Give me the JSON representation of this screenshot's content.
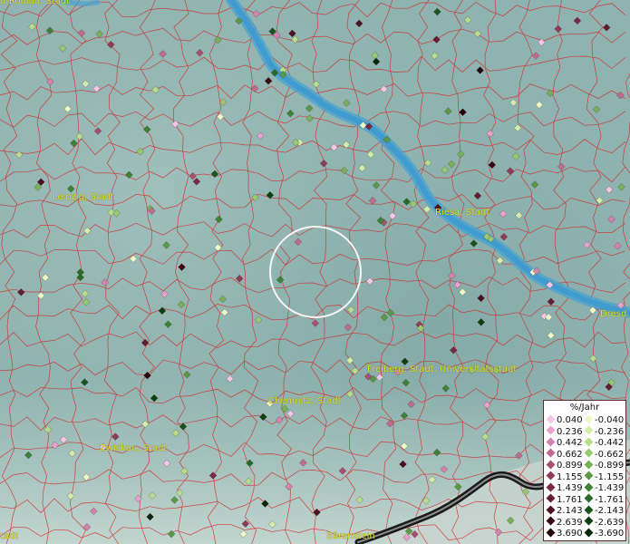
{
  "places": [
    {
      "name": "u-Roßlau, Stadt"
    },
    {
      "name": "Leipzig, Stadt"
    },
    {
      "name": "Riesa, Stadt"
    },
    {
      "name": "Dresd"
    },
    {
      "name": "Freiberg, Stadt, Universitätsstadt"
    },
    {
      "name": "Chemnitz, Stadt"
    },
    {
      "name": "Zwickau, Stadt"
    },
    {
      "name": "tadt"
    },
    {
      "name": "Bärenstein"
    }
  ],
  "legend": {
    "title": "%/Jahr",
    "positive": [
      {
        "label": "0.040",
        "color": "#f4c6e6"
      },
      {
        "label": "0.236",
        "color": "#e8a0cc"
      },
      {
        "label": "0.442",
        "color": "#d483ad"
      },
      {
        "label": "0.662",
        "color": "#c06a8e"
      },
      {
        "label": "0.899",
        "color": "#a8506f"
      },
      {
        "label": "1.155",
        "color": "#8f3a56"
      },
      {
        "label": "1.439",
        "color": "#7a2a42"
      },
      {
        "label": "1.761",
        "color": "#631c30"
      },
      {
        "label": "2.143",
        "color": "#4e1020"
      },
      {
        "label": "2.639",
        "color": "#390612"
      },
      {
        "label": "3.690",
        "color": "#220208"
      }
    ],
    "negative": [
      {
        "label": "-0.040",
        "color": "#eef7c8"
      },
      {
        "label": "-0.236",
        "color": "#d4ecaa"
      },
      {
        "label": "-0.442",
        "color": "#b8dc8c"
      },
      {
        "label": "-0.662",
        "color": "#98c870"
      },
      {
        "label": "-0.899",
        "color": "#78b05a"
      },
      {
        "label": "-1.155",
        "color": "#5a9a46"
      },
      {
        "label": "-1.439",
        "color": "#3e8236"
      },
      {
        "label": "-1.761",
        "color": "#2a6a28"
      },
      {
        "label": "-2.143",
        "color": "#1a541c"
      },
      {
        "label": "-2.639",
        "color": "#0e3e12"
      },
      {
        "label": "-3.690",
        "color": "#062808"
      }
    ]
  },
  "colors": {
    "background": "#8fb3b0",
    "borders": "#d42a2a",
    "river": "#4aa3d0",
    "place_label": "#e8e01a",
    "circle": "#ffffff"
  },
  "markers": [
    {
      "cls": 3,
      "sign": "p"
    },
    {
      "cls": 0,
      "sign": "n"
    },
    {
      "cls": 5,
      "sign": "n"
    },
    {
      "cls": 2,
      "sign": "n"
    },
    {
      "cls": 1,
      "sign": "p"
    },
    {
      "cls": 0,
      "sign": "n"
    },
    {
      "cls": 8,
      "sign": "p"
    },
    {
      "cls": 3,
      "sign": "n"
    },
    {
      "cls": 2,
      "sign": "p"
    },
    {
      "cls": 6,
      "sign": "n"
    },
    {
      "cls": 4,
      "sign": "n"
    },
    {
      "cls": 1,
      "sign": "n"
    },
    {
      "cls": 5,
      "sign": "p"
    },
    {
      "cls": 0,
      "sign": "p"
    },
    {
      "cls": 2,
      "sign": "n"
    },
    {
      "cls": 7,
      "sign": "p"
    },
    {
      "cls": 3,
      "sign": "p"
    },
    {
      "cls": 1,
      "sign": "n"
    },
    {
      "cls": 4,
      "sign": "p"
    },
    {
      "cls": 6,
      "sign": "n"
    },
    {
      "cls": 2,
      "sign": "p"
    },
    {
      "cls": 0,
      "sign": "n"
    },
    {
      "cls": 5,
      "sign": "n"
    },
    {
      "cls": 9,
      "sign": "n"
    },
    {
      "cls": 1,
      "sign": "p"
    },
    {
      "cls": 3,
      "sign": "n"
    },
    {
      "cls": 2,
      "sign": "n"
    },
    {
      "cls": 6,
      "sign": "p"
    },
    {
      "cls": 4,
      "sign": "n"
    },
    {
      "cls": 0,
      "sign": "p"
    },
    {
      "cls": 8,
      "sign": "n"
    },
    {
      "cls": 2,
      "sign": "p"
    },
    {
      "cls": 1,
      "sign": "n"
    },
    {
      "cls": 5,
      "sign": "p"
    },
    {
      "cls": 3,
      "sign": "n"
    },
    {
      "cls": 7,
      "sign": "n"
    },
    {
      "cls": 2,
      "sign": "n"
    },
    {
      "cls": 0,
      "sign": "p"
    },
    {
      "cls": 4,
      "sign": "n"
    },
    {
      "cls": 10,
      "sign": "p"
    },
    {
      "cls": 1,
      "sign": "n"
    },
    {
      "cls": 6,
      "sign": "n"
    },
    {
      "cls": 3,
      "sign": "p"
    },
    {
      "cls": 2,
      "sign": "n"
    },
    {
      "cls": 5,
      "sign": "n"
    },
    {
      "cls": 0,
      "sign": "n"
    },
    {
      "cls": 8,
      "sign": "n"
    },
    {
      "cls": 1,
      "sign": "p"
    },
    {
      "cls": 4,
      "sign": "p"
    },
    {
      "cls": 2,
      "sign": "n"
    },
    {
      "cls": 9,
      "sign": "p"
    },
    {
      "cls": 3,
      "sign": "n"
    },
    {
      "cls": 6,
      "sign": "n"
    },
    {
      "cls": 0,
      "sign": "p"
    },
    {
      "cls": 2,
      "sign": "p"
    },
    {
      "cls": 7,
      "sign": "n"
    },
    {
      "cls": 1,
      "sign": "n"
    },
    {
      "cls": 5,
      "sign": "n"
    },
    {
      "cls": 3,
      "sign": "p"
    },
    {
      "cls": 4,
      "sign": "n"
    },
    {
      "cls": 10,
      "sign": "n"
    },
    {
      "cls": 2,
      "sign": "n"
    },
    {
      "cls": 0,
      "sign": "n"
    },
    {
      "cls": 6,
      "sign": "p"
    },
    {
      "cls": 1,
      "sign": "p"
    },
    {
      "cls": 8,
      "sign": "p"
    },
    {
      "cls": 3,
      "sign": "n"
    },
    {
      "cls": 5,
      "sign": "p"
    },
    {
      "cls": 2,
      "sign": "n"
    },
    {
      "cls": 4,
      "sign": "n"
    },
    {
      "cls": 0,
      "sign": "p"
    },
    {
      "cls": 7,
      "sign": "p"
    },
    {
      "cls": 1,
      "sign": "n"
    },
    {
      "cls": 9,
      "sign": "n"
    },
    {
      "cls": 3,
      "sign": "n"
    },
    {
      "cls": 2,
      "sign": "p"
    },
    {
      "cls": 6,
      "sign": "n"
    },
    {
      "cls": 5,
      "sign": "n"
    },
    {
      "cls": 0,
      "sign": "n"
    },
    {
      "cls": 4,
      "sign": "p"
    }
  ]
}
